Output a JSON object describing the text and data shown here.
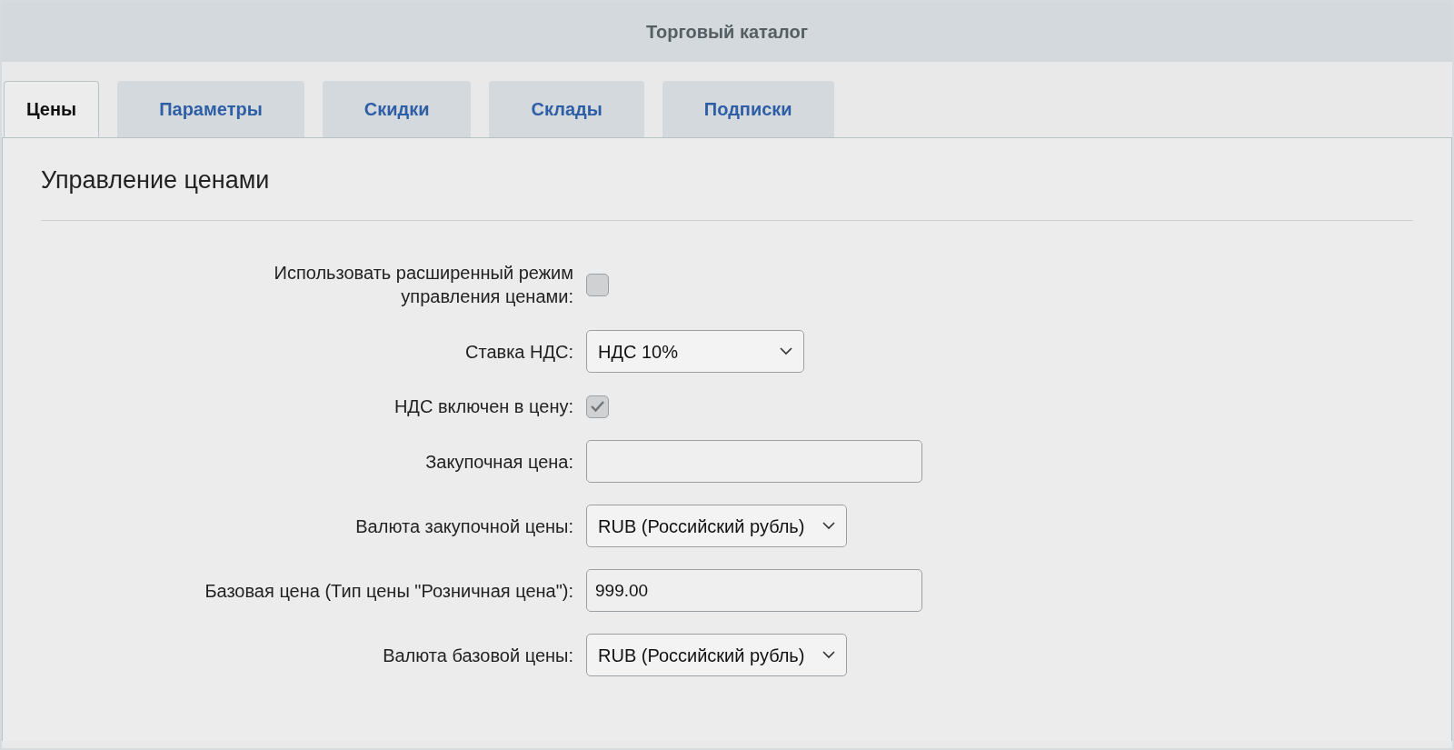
{
  "window": {
    "title": "Торговый каталог"
  },
  "tabs": [
    {
      "label": "Цены",
      "selected": true
    },
    {
      "label": "Параметры",
      "selected": false
    },
    {
      "label": "Скидки",
      "selected": false
    },
    {
      "label": "Склады",
      "selected": false
    },
    {
      "label": "Подписки",
      "selected": false
    }
  ],
  "section": {
    "title": "Управление ценами"
  },
  "fields": [
    {
      "kind": "checkbox",
      "label": "Использовать расширенный режим управления ценами:",
      "checked": false
    },
    {
      "kind": "select",
      "label": "Ставка НДС:",
      "value": "НДС 10%"
    },
    {
      "kind": "checkbox",
      "label": "НДС включен в цену:",
      "checked": true
    },
    {
      "kind": "text",
      "label": "Закупочная цена:"
    },
    {
      "kind": "select",
      "label": "Валюта закупочной цены:",
      "value": "RUB (Российский рубль)"
    },
    {
      "kind": "text",
      "label": "Базовая цена (Тип цены \"Розничная цена\"):",
      "value": "999.00"
    },
    {
      "kind": "select",
      "label": "Валюта базовой цены:",
      "value": "RUB (Российский рубль)"
    }
  ]
}
